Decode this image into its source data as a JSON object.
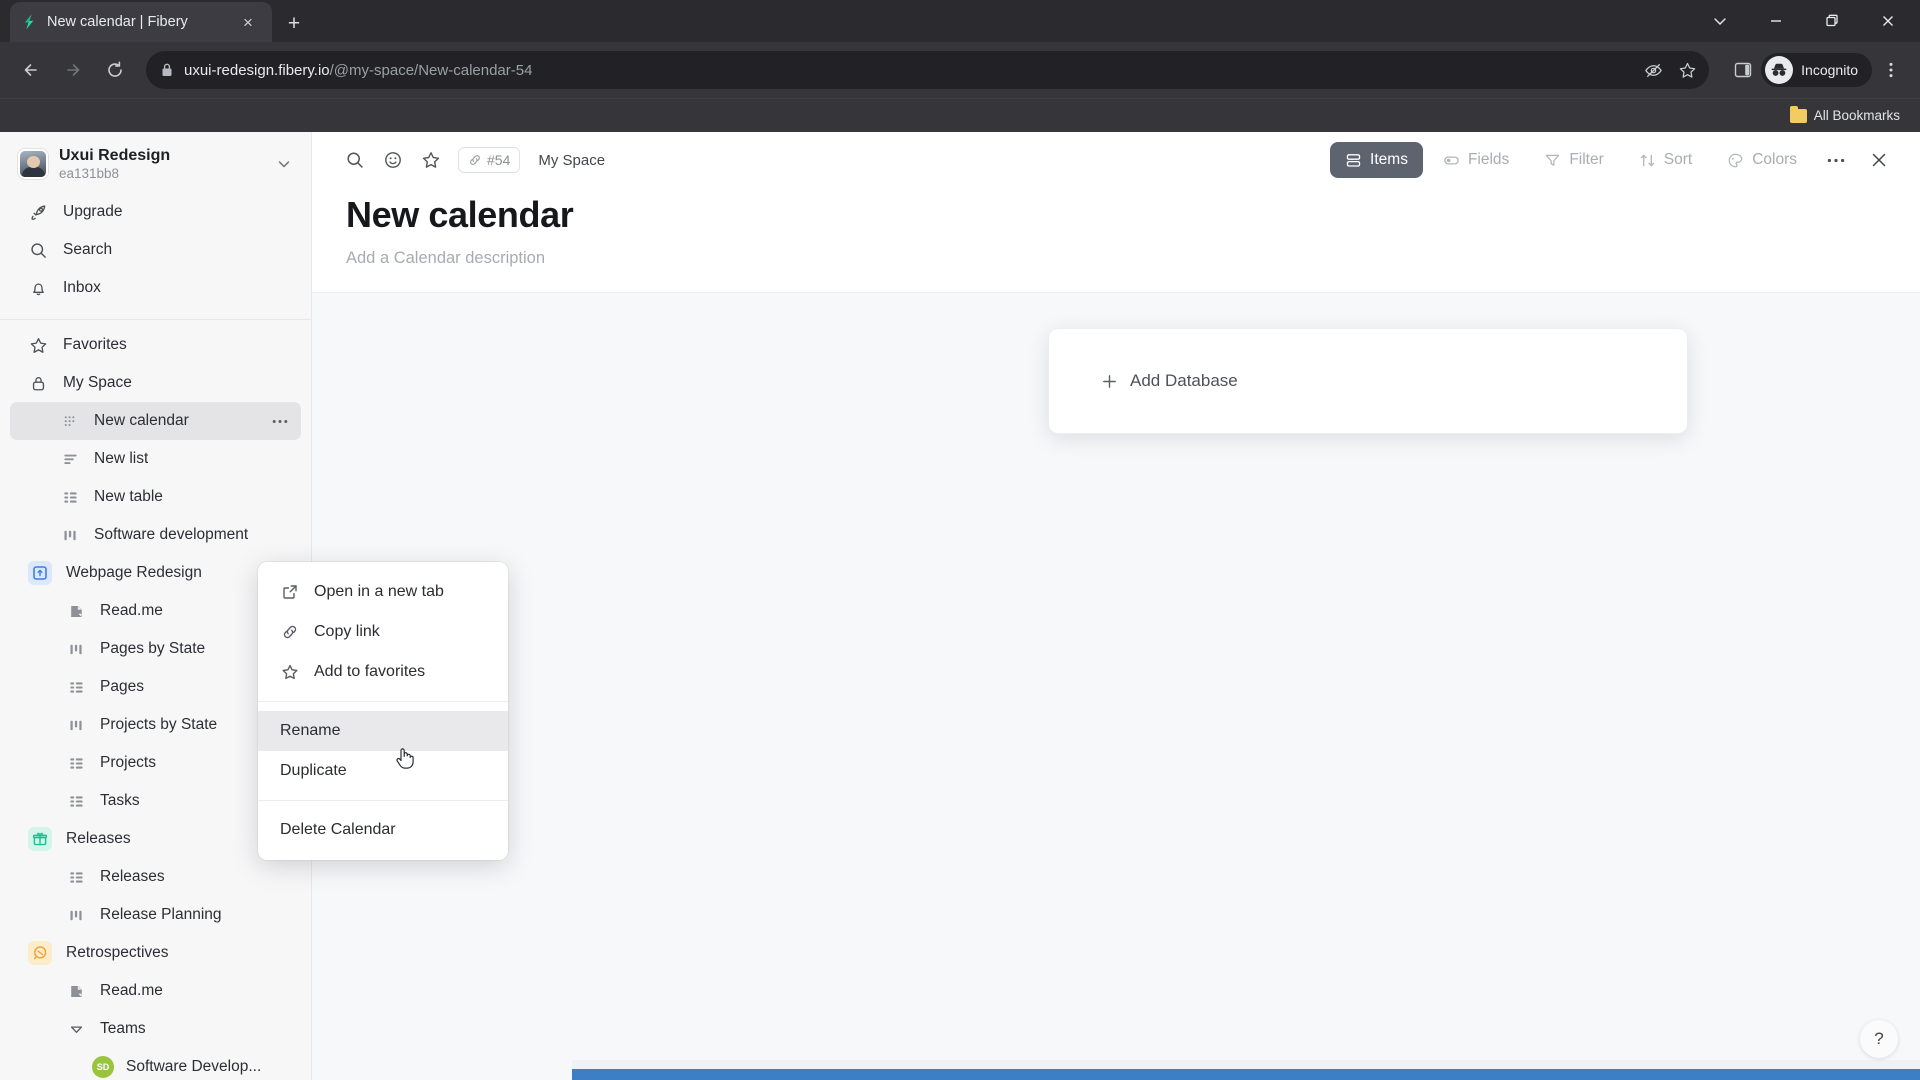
{
  "browser": {
    "tab": {
      "title": "New calendar | Fibery",
      "favicon": "fibery-logo-icon",
      "close": "×"
    },
    "new_tab": "+",
    "window_controls": {
      "minimize": "—",
      "maximize": "❐",
      "close": "✕",
      "tab_search": "⌄"
    },
    "url_display": "uxui-redesign.fibery.io",
    "url_path": "/@my-space/New-calendar-54",
    "profile_label": "Incognito",
    "bookmarks_label": "All Bookmarks"
  },
  "sidebar": {
    "workspace": {
      "name": "Uxui Redesign",
      "id": "ea131bb8"
    },
    "top_items": [
      {
        "label": "Upgrade",
        "icon": "rocket-icon"
      },
      {
        "label": "Search",
        "icon": "search-icon"
      },
      {
        "label": "Inbox",
        "icon": "bell-icon"
      }
    ],
    "nav_items": [
      {
        "label": "Favorites",
        "icon": "star-icon"
      },
      {
        "label": "My Space",
        "icon": "lock-icon"
      }
    ],
    "my_space_children": [
      {
        "label": "New calendar",
        "icon": "calendar-grid-icon",
        "active": true
      },
      {
        "label": "New list",
        "icon": "list-icon"
      },
      {
        "label": "New table",
        "icon": "table-icon"
      },
      {
        "label": "Software development",
        "icon": "board-icon"
      }
    ],
    "spaces": [
      {
        "label": "Webpage Redesign",
        "icon": "webpage-space-icon",
        "children": [
          {
            "label": "Read.me",
            "icon": "document-icon"
          },
          {
            "label": "Pages by State",
            "icon": "board-icon"
          },
          {
            "label": "Pages",
            "icon": "table-icon"
          },
          {
            "label": "Projects by State",
            "icon": "board-icon"
          },
          {
            "label": "Projects",
            "icon": "table-icon"
          },
          {
            "label": "Tasks",
            "icon": "table-icon"
          }
        ]
      },
      {
        "label": "Releases",
        "icon": "gift-icon",
        "children": [
          {
            "label": "Releases",
            "icon": "table-icon"
          },
          {
            "label": "Release Planning",
            "icon": "board-icon"
          }
        ]
      },
      {
        "label": "Retrospectives",
        "icon": "retro-icon",
        "children": [
          {
            "label": "Read.me",
            "icon": "document-icon"
          }
        ]
      }
    ],
    "teams": {
      "label": "Teams",
      "icon": "chevron-down-icon"
    },
    "team_members": [
      {
        "label": "Software Develop...",
        "initials": "SD"
      }
    ]
  },
  "main": {
    "toolbar_left_icons": [
      {
        "name": "search-icon"
      },
      {
        "name": "emoji-icon"
      },
      {
        "name": "star-icon"
      }
    ],
    "id_chip": "#54",
    "breadcrumb_space": "My Space",
    "toolbar_right": [
      {
        "label": "Items",
        "icon": "items-icon",
        "active": true
      },
      {
        "label": "Fields",
        "icon": "fields-icon",
        "active": false
      },
      {
        "label": "Filter",
        "icon": "filter-icon",
        "active": false
      },
      {
        "label": "Sort",
        "icon": "sort-icon",
        "active": false
      },
      {
        "label": "Colors",
        "icon": "colors-icon",
        "active": false
      }
    ],
    "more_label": "…",
    "close_label": "✕",
    "title": "New calendar",
    "description_placeholder": "Add a Calendar description",
    "add_database_label": "Add Database",
    "add_database_plus": "+",
    "help_label": "?"
  },
  "context_menu": {
    "items": [
      {
        "label": "Open in a new tab",
        "icon": "external-link-icon",
        "has_icon": true,
        "highlight": false
      },
      {
        "label": "Copy link",
        "icon": "link-icon",
        "has_icon": true,
        "highlight": false
      },
      {
        "label": "Add to favorites",
        "icon": "star-icon",
        "has_icon": true,
        "highlight": false
      }
    ],
    "items2": [
      {
        "label": "Rename",
        "highlight": true
      },
      {
        "label": "Duplicate",
        "highlight": false
      }
    ],
    "items3": [
      {
        "label": "Delete Calendar",
        "highlight": false
      }
    ]
  },
  "colors": {
    "accent_active": "#5d6470",
    "sidebar_bg": "#f7f7f8",
    "browser_chrome": "#35353a",
    "blue_bar": "#3c7fc4",
    "gift_icon": "#1fbf8f",
    "retro_icon": "#e8a33d",
    "team_avatar": "#9ac33e"
  }
}
